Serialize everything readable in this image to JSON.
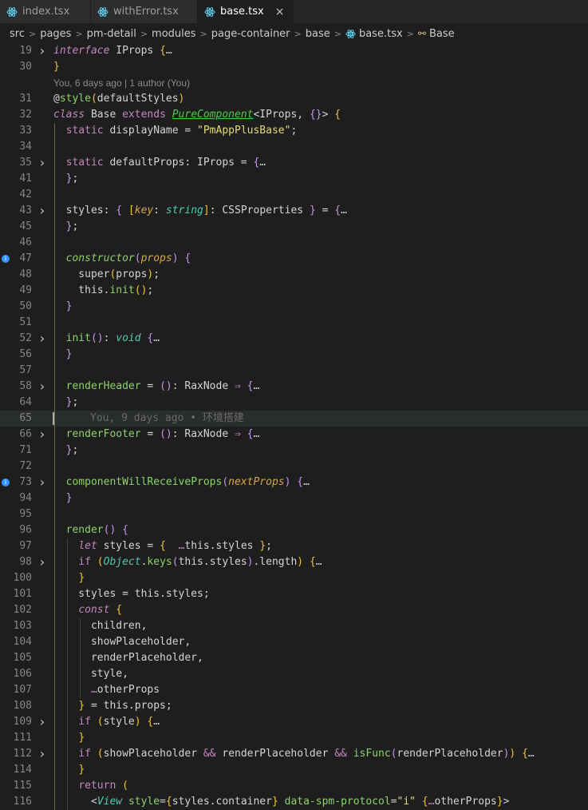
{
  "tabs": [
    {
      "label": "index.tsx"
    },
    {
      "label": "withError.tsx"
    },
    {
      "label": "base.tsx",
      "close": "×"
    }
  ],
  "breadcrumb": [
    "src",
    "pages",
    "pm-detail",
    "modules",
    "page-container",
    "base",
    "base.tsx",
    "Base"
  ],
  "blame_header": "You, 6 days ago | 1 author (You)",
  "inline_blame": "You, 9 days ago • 环境搭建",
  "lines": [
    {
      "n": "19",
      "fold": true,
      "html": "<span class='kw'>interface</span> IProps <span class='par'>{</span><span class='ellip'>…</span>"
    },
    {
      "n": "30",
      "html": "<span class='par'>}</span>"
    },
    {
      "blame": true
    },
    {
      "n": "31",
      "html": "@<span class='fng'>style</span><span class='par'>(</span>defaultStyles<span class='par'>)</span>"
    },
    {
      "n": "32",
      "html": "<span class='kw'>class</span> Base <span class='kw2'>extends</span> <span class='cls'>PureComponent</span>&lt;IProps, <span class='purple'>{}</span>&gt; <span class='par'>{</span>"
    },
    {
      "n": "33",
      "html": "  <span class='kw2'>static</span> displayName = <span class='str'>\"PmAppPlusBase\"</span>;"
    },
    {
      "n": "34",
      "html": ""
    },
    {
      "n": "35",
      "fold": true,
      "html": "  <span class='kw2'>static</span> defaultProps: IProps = <span class='purple'>{</span><span class='ellip'>…</span>"
    },
    {
      "n": "41",
      "html": "  <span class='purple'>}</span>;"
    },
    {
      "n": "42",
      "html": ""
    },
    {
      "n": "43",
      "fold": true,
      "html": "  styles: <span class='purple'>{</span> <span class='par'>[</span><span class='orange'>key</span>: <span class='teal'>string</span><span class='par'>]</span>: CSSProperties <span class='purple'>}</span> = <span class='purple'>{</span><span class='ellip'>…</span>"
    },
    {
      "n": "45",
      "html": "  <span class='purple'>}</span>;"
    },
    {
      "n": "46",
      "html": ""
    },
    {
      "n": "47",
      "dot": true,
      "html": "  <span class='fng it'>constructor</span><span class='purple'>(</span><span class='orange'>props</span><span class='purple'>)</span> <span class='purple'>{</span>"
    },
    {
      "n": "48",
      "html": "    super<span class='par'>(</span>props<span class='par'>)</span>;"
    },
    {
      "n": "49",
      "html": "    this.<span class='fng'>init</span><span class='par'>()</span>;"
    },
    {
      "n": "50",
      "html": "  <span class='purple'>}</span>"
    },
    {
      "n": "51",
      "html": ""
    },
    {
      "n": "52",
      "fold": true,
      "html": "  <span class='fng'>init</span><span class='purple'>()</span>: <span class='teal'>void</span> <span class='purple'>{</span><span class='ellip'>…</span>"
    },
    {
      "n": "56",
      "html": "  <span class='purple'>}</span>"
    },
    {
      "n": "57",
      "html": ""
    },
    {
      "n": "58",
      "fold": true,
      "html": "  <span class='fng'>renderHeader</span> = <span class='purple'>()</span>: RaxNode <span class='kw2'>⇒</span> <span class='purple'>{</span><span class='ellip'>…</span>"
    },
    {
      "n": "64",
      "html": "  <span class='purple'>}</span>;"
    },
    {
      "n": "65",
      "hl": true,
      "html": "",
      "ghost": true
    },
    {
      "n": "66",
      "fold": true,
      "html": "  <span class='fng'>renderFooter</span> = <span class='purple'>()</span>: RaxNode <span class='kw2'>⇒</span> <span class='purple'>{</span><span class='ellip'>…</span>"
    },
    {
      "n": "71",
      "html": "  <span class='purple'>}</span>;"
    },
    {
      "n": "72",
      "html": ""
    },
    {
      "n": "73",
      "dot": true,
      "fold": true,
      "html": "  <span class='fng'>componentWillReceiveProps</span><span class='purple'>(</span><span class='orange'>nextProps</span><span class='purple'>)</span> <span class='purple'>{</span><span class='ellip'>…</span>"
    },
    {
      "n": "94",
      "html": "  <span class='purple'>}</span>"
    },
    {
      "n": "95",
      "html": ""
    },
    {
      "n": "96",
      "html": "  <span class='fng'>render</span><span class='purple'>()</span> <span class='purple'>{</span>"
    },
    {
      "n": "97",
      "html": "    <span class='kw'>let</span> styles = <span class='par'>{</span>  <span class='kw2'>…</span>this.styles <span class='par'>}</span>;"
    },
    {
      "n": "98",
      "fold": true,
      "html": "    <span class='kw2'>if</span> <span class='par'>(</span><span class='teal'>Object</span>.<span class='fng'>keys</span><span class='purple'>(</span>this.styles<span class='purple'>)</span>.length<span class='par'>)</span> <span class='par'>{</span><span class='ellip'>…</span>"
    },
    {
      "n": "100",
      "html": "    <span class='par'>}</span>"
    },
    {
      "n": "101",
      "html": "    styles = this.styles;"
    },
    {
      "n": "102",
      "html": "    <span class='kw'>const</span> <span class='par'>{</span>"
    },
    {
      "n": "103",
      "html": "      children,"
    },
    {
      "n": "104",
      "html": "      showPlaceholder,"
    },
    {
      "n": "105",
      "html": "      renderPlaceholder,"
    },
    {
      "n": "106",
      "html": "      style,"
    },
    {
      "n": "107",
      "html": "      <span class='kw2'>…</span>otherProps"
    },
    {
      "n": "108",
      "html": "    <span class='par'>}</span> = this.props;"
    },
    {
      "n": "109",
      "fold": true,
      "html": "    <span class='kw2'>if</span> <span class='par'>(</span>style<span class='par'>)</span> <span class='par'>{</span><span class='ellip'>…</span>"
    },
    {
      "n": "111",
      "html": "    <span class='par'>}</span>"
    },
    {
      "n": "112",
      "fold": true,
      "html": "    <span class='kw2'>if</span> <span class='par'>(</span>showPlaceholder <span class='kw2'>&amp;&amp;</span> renderPlaceholder <span class='kw2'>&amp;&amp;</span> <span class='fng'>isFunc</span><span class='purple'>(</span>renderPlaceholder<span class='purple'>)</span><span class='par'>)</span> <span class='par'>{</span><span class='ellip'>…</span>"
    },
    {
      "n": "114",
      "html": "    <span class='par'>}</span>"
    },
    {
      "n": "115",
      "html": "    <span class='kw2'>return</span> <span class='par'>(</span>"
    },
    {
      "n": "116",
      "html": "      &lt;<span class='teal'>View</span> <span class='fng'>style</span>=<span class='par'>{</span>styles.container<span class='par'>}</span> <span class='fng'>data-spm-protocol</span>=<span class='str'>\"i\"</span> <span class='par'>{</span><span class='kw2'>…</span>otherProps<span class='par'>}</span>&gt;"
    }
  ]
}
